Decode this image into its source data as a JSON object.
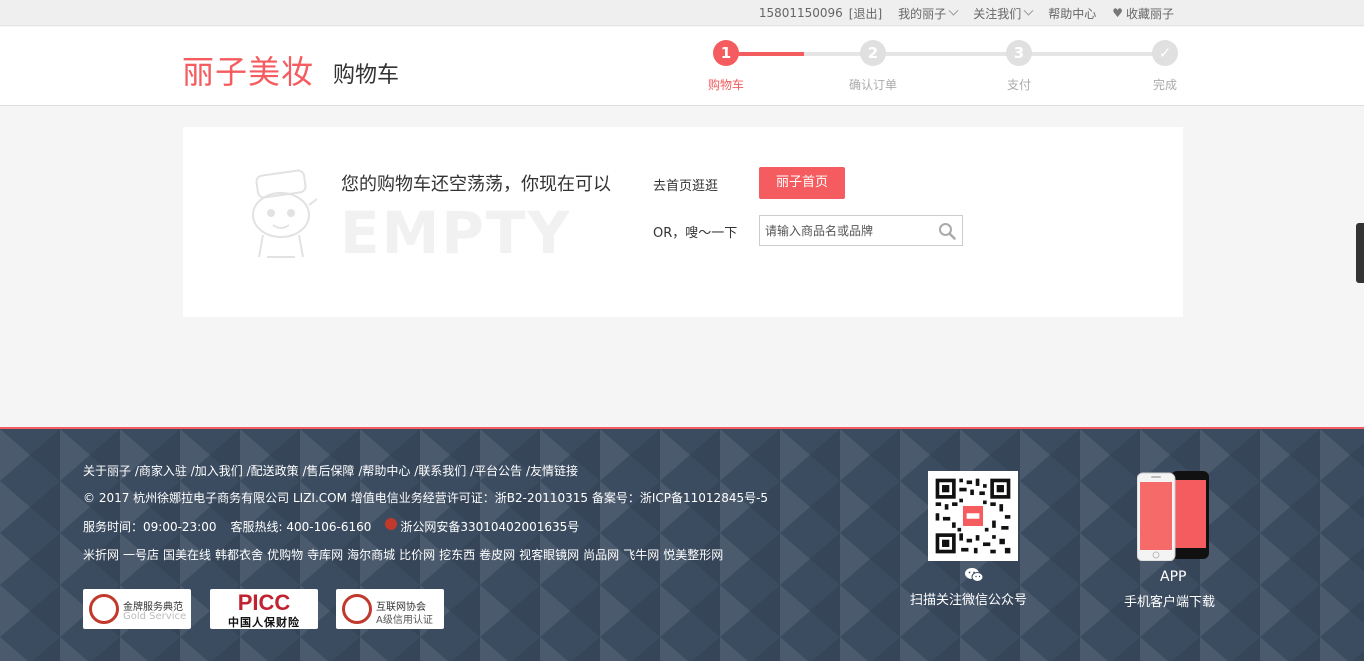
{
  "topbar": {
    "phone": "15801150096",
    "logout": "[退出]",
    "my_lizi": "我的丽子",
    "follow": "关注我们",
    "help": "帮助中心",
    "favorite": "收藏丽子"
  },
  "header": {
    "logo": "丽子美妆",
    "title": "购物车",
    "steps": [
      {
        "num": "1",
        "label": "购物车"
      },
      {
        "num": "2",
        "label": "确认订单"
      },
      {
        "num": "3",
        "label": "支付"
      },
      {
        "num": "✓",
        "label": "完成"
      }
    ],
    "current_step": 1
  },
  "empty": {
    "watermark": "EMPTY",
    "message": "您的购物车还空荡荡，你现在可以",
    "go_home_text": "去首页逛逛",
    "home_button": "丽子首页",
    "or_text": "OR，嗖～一下",
    "search_placeholder": "请输入商品名或品牌"
  },
  "footer": {
    "links": [
      "关于丽子",
      "商家入驻",
      "加入我们",
      "配送政策",
      "售后保障",
      "帮助中心",
      "联系我们",
      "平台公告",
      "友情链接"
    ],
    "copyright": "© 2017 杭州徐娜拉电子商务有限公司 LIZI.COM 增值电信业务经营许可证：浙B2-20110315 备案号：浙ICP备11012845号-5",
    "service_time": "服务时间：09:00-23:00",
    "hotline": "客服热线: 400-106-6160",
    "police": "浙公网安备33010402001635号",
    "friends": [
      "米折网",
      "一号店",
      "国美在线",
      "韩都衣舍",
      "优购物",
      "寺库网",
      "海尔商城",
      "比价网",
      "挖东西",
      "卷皮网",
      "视客眼镜网",
      "尚品网",
      "飞牛网",
      "悦美整形网"
    ],
    "cert1_title": "金牌服务典范",
    "cert1_sub": "Gold Service",
    "cert2_title": "PICC",
    "cert2_sub": "中国人保财险",
    "cert3_title": "互联网协会",
    "cert3_sub": "A级信用认证",
    "qr_label": "扫描关注微信公众号",
    "app_label": "APP",
    "app_sub": "手机客户端下载"
  },
  "colors": {
    "brand": "#f45c5f",
    "footer_bg": "#3b4c60"
  }
}
